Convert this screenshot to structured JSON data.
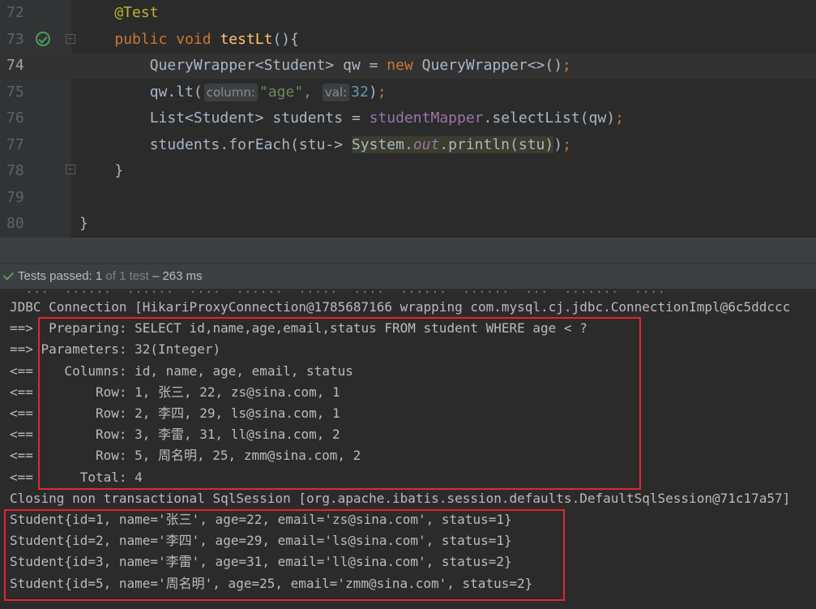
{
  "editor": {
    "lines": [
      {
        "num": "72",
        "tokens": [
          {
            "t": "    @Test",
            "c": "ann"
          }
        ]
      },
      {
        "num": "73",
        "tokens": [
          {
            "t": "    ",
            "c": ""
          },
          {
            "t": "public",
            "c": "kw"
          },
          {
            "t": " ",
            "c": ""
          },
          {
            "t": "void",
            "c": "kw"
          },
          {
            "t": " ",
            "c": ""
          },
          {
            "t": "testLt",
            "c": "fn"
          },
          {
            "t": "(){",
            "c": ""
          }
        ]
      },
      {
        "num": "74",
        "tokens": [
          {
            "t": "        QueryWrapper<Student> qw = ",
            "c": ""
          },
          {
            "t": "new",
            "c": "kw"
          },
          {
            "t": " QueryWrapper<>()",
            "c": ""
          },
          {
            "t": ";",
            "c": "kw"
          }
        ]
      },
      {
        "num": "75",
        "tokens": [
          {
            "t": "        qw.lt(",
            "c": ""
          },
          {
            "t": "column:",
            "c": "hint"
          },
          {
            "t": "\"age\"",
            "c": "str"
          },
          {
            "t": ",",
            "c": "kw"
          },
          {
            "t": " ",
            "c": ""
          },
          {
            "t": "val:",
            "c": "hint"
          },
          {
            "t": "32",
            "c": "num"
          },
          {
            "t": ")",
            "c": ""
          },
          {
            "t": ";",
            "c": "kw"
          }
        ]
      },
      {
        "num": "76",
        "tokens": [
          {
            "t": "        List<Student> students = ",
            "c": ""
          },
          {
            "t": "studentMapper",
            "c": "field"
          },
          {
            "t": ".selectList(qw)",
            "c": ""
          },
          {
            "t": ";",
            "c": "kw"
          }
        ]
      },
      {
        "num": "77",
        "tokens": [
          {
            "t": "        students.forEach(stu-> ",
            "c": ""
          },
          {
            "t": "System.",
            "c": "hl"
          },
          {
            "t": "out",
            "c": "ital hl"
          },
          {
            "t": ".println(stu)",
            "c": "hl"
          },
          {
            "t": ")",
            "c": ""
          },
          {
            "t": ";",
            "c": "kw"
          }
        ]
      },
      {
        "num": "78",
        "tokens": [
          {
            "t": "    }",
            "c": ""
          }
        ]
      },
      {
        "num": "79",
        "tokens": [
          {
            "t": "",
            "c": ""
          }
        ]
      },
      {
        "num": "80",
        "tokens": [
          {
            "t": "}",
            "c": ""
          }
        ]
      }
    ],
    "current_line": "74"
  },
  "status": {
    "prefix": "Tests passed: ",
    "count": "1",
    "of": " of 1 test",
    "duration": " – 263 ms"
  },
  "console": {
    "clipped": "  ...  ......  ......  ....  ......  .....  ....  ......  ......  ...  .......  ....",
    "lines": [
      "JDBC Connection [HikariProxyConnection@1785687166 wrapping com.mysql.cj.jdbc.ConnectionImpl@6c5ddccc",
      "==>  Preparing: SELECT id,name,age,email,status FROM student WHERE age < ?",
      "==> Parameters: 32(Integer)",
      "<==    Columns: id, name, age, email, status",
      "<==        Row: 1, 张三, 22, zs@sina.com, 1",
      "<==        Row: 2, 李四, 29, ls@sina.com, 1",
      "<==        Row: 3, 李雷, 31, ll@sina.com, 2",
      "<==        Row: 5, 周名明, 25, zmm@sina.com, 2",
      "<==      Total: 4",
      "Closing non transactional SqlSession [org.apache.ibatis.session.defaults.DefaultSqlSession@71c17a57]",
      "Student{id=1, name='张三', age=22, email='zs@sina.com', status=1}",
      "Student{id=2, name='李四', age=29, email='ls@sina.com', status=1}",
      "Student{id=3, name='李雷', age=31, email='ll@sina.com', status=2}",
      "Student{id=5, name='周名明', age=25, email='zmm@sina.com', status=2}"
    ]
  },
  "colors": {
    "highlight_box": "#e3262e",
    "pass_green": "#629755"
  }
}
